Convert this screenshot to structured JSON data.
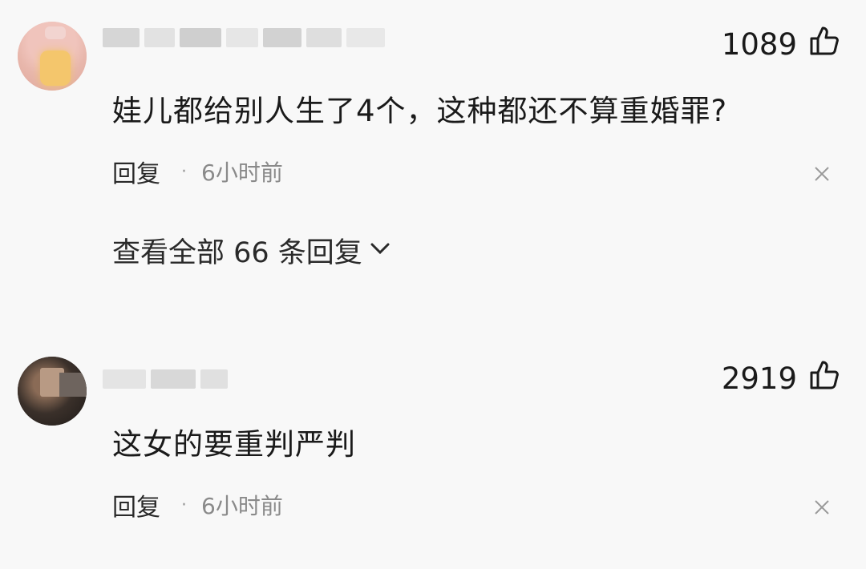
{
  "comments": [
    {
      "likes": "1089",
      "text": "娃儿都给别人生了4个，这种都还不算重婚罪?",
      "reply_label": "回复",
      "separator": "·",
      "time": "6小时前",
      "view_replies": "查看全部 66 条回复"
    },
    {
      "likes": "2919",
      "text": "这女的要重判严判",
      "reply_label": "回复",
      "separator": "·",
      "time": "6小时前"
    }
  ],
  "icons": {
    "like": "thumbs-up-icon",
    "close": "close-icon",
    "expand": "chevron-down-icon"
  }
}
